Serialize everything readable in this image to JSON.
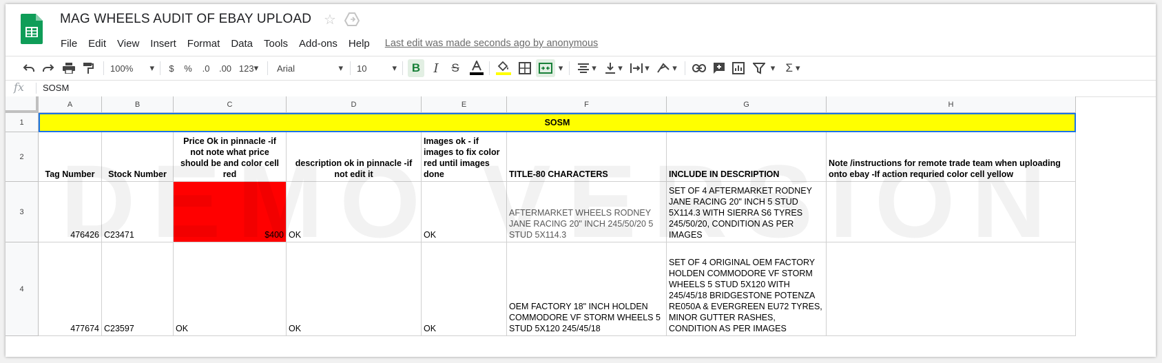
{
  "doc": {
    "title": "MAG WHEELS AUDIT OF EBAY UPLOAD",
    "last_edit": "Last edit was made seconds ago by anonymous"
  },
  "menu": [
    "File",
    "Edit",
    "View",
    "Insert",
    "Format",
    "Data",
    "Tools",
    "Add-ons",
    "Help"
  ],
  "toolbar": {
    "zoom": "100%",
    "currency": "$",
    "percent": "%",
    "decimal_decrease": ".0",
    "decimal_increase": ".00",
    "more_formats": "123",
    "font": "Arial",
    "font_size": "10",
    "sigma": "Σ"
  },
  "formula_bar": {
    "fx": "fx",
    "value": "SOSM"
  },
  "columns": [
    "A",
    "B",
    "C",
    "D",
    "E",
    "F",
    "G",
    "H"
  ],
  "rows": [
    "1",
    "2",
    "3",
    "4"
  ],
  "sheet": {
    "row1": "SOSM",
    "headers": [
      "Tag Number",
      "Stock Number",
      "Price Ok in pinnacle -if not note what price should be and color cell red",
      "description ok in pinnacle -if not edit it",
      "Images ok - if images to fix color red until images done",
      "TITLE-80 CHARACTERS",
      "INCLUDE IN DESCRIPTION",
      "Note /instructions for remote trade team when uploading onto ebay -If action requried color cell yellow"
    ],
    "data": [
      [
        "476426",
        "C23471",
        "$400",
        "OK",
        "OK",
        "AFTERMARKET WHEELS RODNEY JANE RACING 20\" INCH 245/50/20 5 STUD 5X114.3",
        "SET OF 4 AFTERMARKET RODNEY JANE RACING 20\" INCH 5 STUD 5X114.3 WITH SIERRA S6 TYRES 245/50/20, CONDITION AS PER IMAGES",
        ""
      ],
      [
        "477674",
        "C23597",
        "OK",
        "OK",
        "OK",
        "OEM FACTORY 18\" INCH HOLDEN COMMODORE VF STORM WHEELS 5 STUD 5X120 245/45/18",
        "SET OF 4 ORIGINAL OEM FACTORY HOLDEN COMMODORE VF STORM WHEELS 5 STUD 5X120 WITH 245/45/18 BRIDGESTONE POTENZA RE050A & EVERGREEN EU72 TYRES, MINOR GUTTER RASHES, CONDITION AS PER IMAGES",
        ""
      ]
    ]
  },
  "watermark": "DEMO VERSION",
  "colors": {
    "highlight_yellow": "#ffff00",
    "flag_red": "#ff0000",
    "sheets_green": "#0f9d58"
  }
}
